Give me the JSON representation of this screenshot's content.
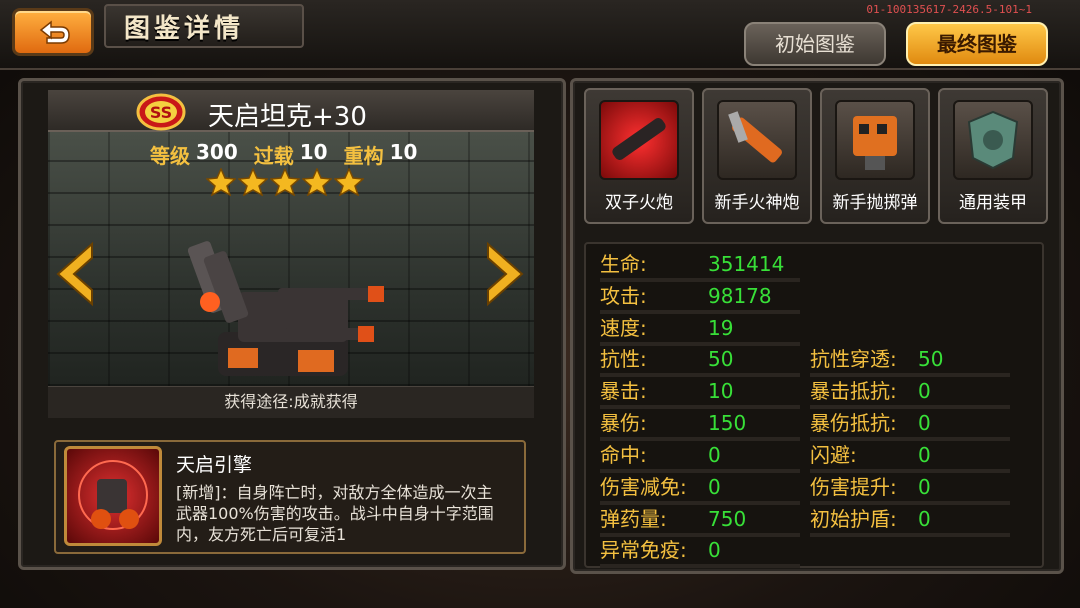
{
  "header": {
    "title": "图鉴详情",
    "version": "01-100135617-2426.5-101~1",
    "tabs": [
      {
        "label": "初始图鉴",
        "active": false
      },
      {
        "label": "最终图鉴",
        "active": true
      }
    ]
  },
  "unit": {
    "rank": "SS",
    "name": "天启坦克+30",
    "stats": [
      {
        "label": "等级",
        "value": "300"
      },
      {
        "label": "过载",
        "value": "10"
      },
      {
        "label": "重构",
        "value": "10"
      }
    ],
    "stars": 5,
    "source": "获得途径:成就获得"
  },
  "skill": {
    "name": "天启引擎",
    "description": "[新增]：自身阵亡时，对敌方全体造成一次主武器100%伤害的攻击。战斗中自身十字范围内，友方死亡后可复活1"
  },
  "equipment": [
    {
      "label": "双子火炮",
      "icon": "twin-cannon-icon"
    },
    {
      "label": "新手火神炮",
      "icon": "vulcan-cannon-icon"
    },
    {
      "label": "新手抛掷弹",
      "icon": "grenade-launcher-icon"
    },
    {
      "label": "通用装甲",
      "icon": "armor-icon"
    }
  ],
  "attributes": {
    "left": [
      {
        "label": "生命:",
        "value": "351414"
      },
      {
        "label": "攻击:",
        "value": "98178"
      },
      {
        "label": "速度:",
        "value": "19"
      },
      {
        "label": "抗性:",
        "value": "50"
      },
      {
        "label": "暴击:",
        "value": "10"
      },
      {
        "label": "暴伤:",
        "value": "150"
      },
      {
        "label": "命中:",
        "value": "0"
      },
      {
        "label": "伤害减免:",
        "value": "0"
      },
      {
        "label": "弹药量:",
        "value": "750"
      },
      {
        "label": "异常免疫:",
        "value": "0"
      }
    ],
    "right": [
      {
        "label": "抗性穿透:",
        "value": "50"
      },
      {
        "label": "暴击抵抗:",
        "value": "0"
      },
      {
        "label": "暴伤抵抗:",
        "value": "0"
      },
      {
        "label": "闪避:",
        "value": "0"
      },
      {
        "label": "伤害提升:",
        "value": "0"
      },
      {
        "label": "初始护盾:",
        "value": "0"
      }
    ]
  },
  "colors": {
    "accent": "#f4c040",
    "value_green": "#38e038",
    "active_tab": "#f0a020"
  }
}
